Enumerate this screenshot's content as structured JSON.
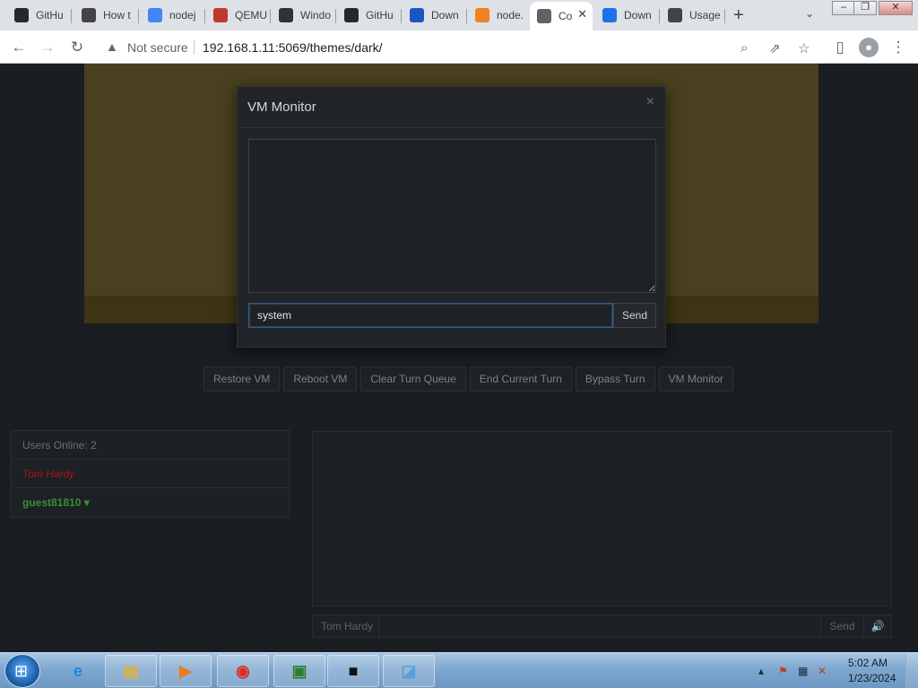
{
  "browser": {
    "tabs": [
      {
        "title": "GitHu",
        "icon": "github-icon",
        "color": "#24292e"
      },
      {
        "title": "How t",
        "icon": "ask-ubuntu-icon",
        "color": "#444"
      },
      {
        "title": "nodej",
        "icon": "google-icon",
        "color": "#4285f4"
      },
      {
        "title": "QEMU",
        "icon": "qemu-icon",
        "color": "#c0392b"
      },
      {
        "title": "Windo",
        "icon": "archive-icon",
        "color": "#333"
      },
      {
        "title": "GitHu",
        "icon": "github-icon",
        "color": "#24292e"
      },
      {
        "title": "Down",
        "icon": "n-icon",
        "color": "#1a56c2"
      },
      {
        "title": "node.",
        "icon": "stackoverflow-icon",
        "color": "#f48024"
      },
      {
        "title": "Co",
        "icon": "globe-icon",
        "color": "#5f6368"
      },
      {
        "title": "Down",
        "icon": "download-icon",
        "color": "#1a73e8"
      },
      {
        "title": "Usage",
        "icon": "docs-icon",
        "color": "#444"
      }
    ],
    "active_tab_index": 8,
    "security_label": "Not secure",
    "url": "192.168.1.11:5069/themes/dark/"
  },
  "page": {
    "actions": [
      "Restore VM",
      "Reboot VM",
      "Clear Turn Queue",
      "End Current Turn",
      "Bypass Turn",
      "VM Monitor"
    ],
    "users_online": "Users Online: 2",
    "users": [
      "Tom Hardy",
      "guest81810 ▾"
    ],
    "chat": {
      "username": "Tom Hardy",
      "send": "Send",
      "input_value": ""
    }
  },
  "modal": {
    "title": "VM Monitor",
    "close": "×",
    "output": "",
    "input_value": "system",
    "send": "Send"
  },
  "taskbar": {
    "apps": [
      "ie-icon",
      "explorer-icon",
      "media-player-icon",
      "chrome-icon",
      "remote-desktop-icon",
      "cmd-icon",
      "notepad-icon"
    ],
    "time": "5:02 AM",
    "date": "1/23/2024"
  },
  "colors": {
    "accent": "#375a7f",
    "page_bg": "#1a1d21",
    "vm_screen": "#4a401f",
    "user_red": "#a31616",
    "user_green": "#3a8f34"
  }
}
